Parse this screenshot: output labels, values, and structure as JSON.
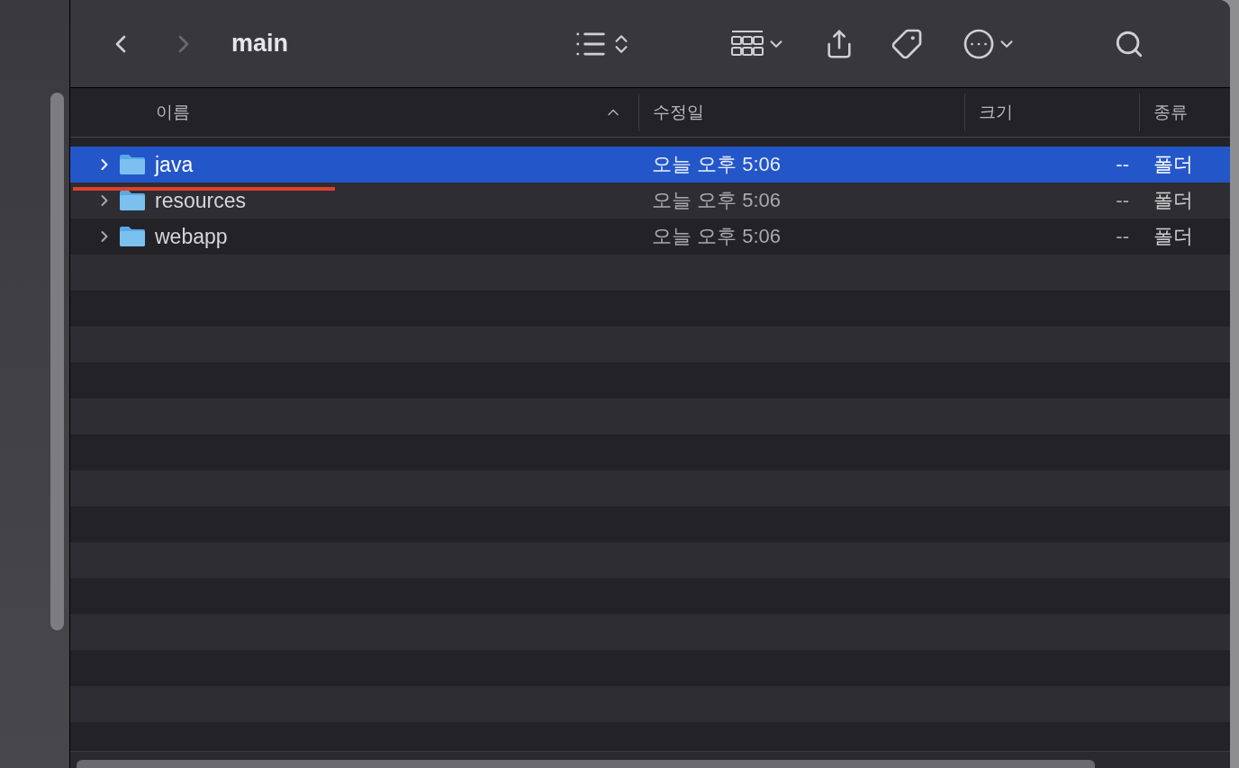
{
  "window": {
    "title": "main"
  },
  "navigation": [
    {
      "kind": "back",
      "disabled": false
    },
    {
      "kind": "forward",
      "disabled": true
    }
  ],
  "columns": [
    {
      "label": "이름",
      "sorted": true
    },
    {
      "label": "수정일",
      "sorted": false
    },
    {
      "label": "크기",
      "sorted": false
    },
    {
      "label": "종류",
      "sorted": false
    }
  ],
  "rows": [
    {
      "name": "java",
      "modified": "오늘 오후 5:06",
      "size": "--",
      "kind": "폴더",
      "selected": true
    },
    {
      "name": "resources",
      "modified": "오늘 오후 5:06",
      "size": "--",
      "kind": "폴더",
      "selected": false
    },
    {
      "name": "webapp",
      "modified": "오늘 오후 5:06",
      "size": "--",
      "kind": "폴더",
      "selected": false
    }
  ]
}
